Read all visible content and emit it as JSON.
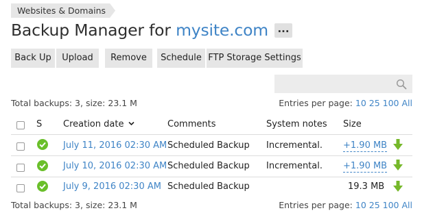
{
  "breadcrumb": {
    "label": "Websites & Domains"
  },
  "header": {
    "title_prefix": "Backup Manager for",
    "site_name": "mysite.com",
    "more_label": "..."
  },
  "toolbar": {
    "backup_label": "Back Up",
    "upload_label": "Upload",
    "remove_label": "Remove",
    "schedule_label": "Schedule",
    "ftp_label": "FTP Storage Settings"
  },
  "search": {
    "placeholder": "",
    "icon": "search-icon"
  },
  "summary": {
    "text": "Total backups: 3, size: 23.1 M"
  },
  "pagination": {
    "label": "Entries per page:",
    "options": [
      "10",
      "25",
      "100",
      "All"
    ]
  },
  "table": {
    "columns": {
      "status": "S",
      "creation_date": "Creation date",
      "comments": "Comments",
      "system_notes": "System notes",
      "size": "Size"
    },
    "rows": [
      {
        "date": "July 11, 2016 02:30 AM",
        "comment": "Scheduled Backup",
        "notes": "Incremental.",
        "size": "+1.90 MB"
      },
      {
        "date": "July 10, 2016 02:30 AM",
        "comment": "Scheduled Backup",
        "notes": "Incremental.",
        "size": "+1.90 MB"
      },
      {
        "date": "July 9, 2016 02:30 AM",
        "comment": "Scheduled Backup",
        "notes": "",
        "size": "19.3 MB"
      }
    ]
  },
  "colors": {
    "accent": "#3f84c6",
    "ok": "#6abf2a",
    "download": "#76b82a",
    "button_bg": "#e6e6e6"
  }
}
